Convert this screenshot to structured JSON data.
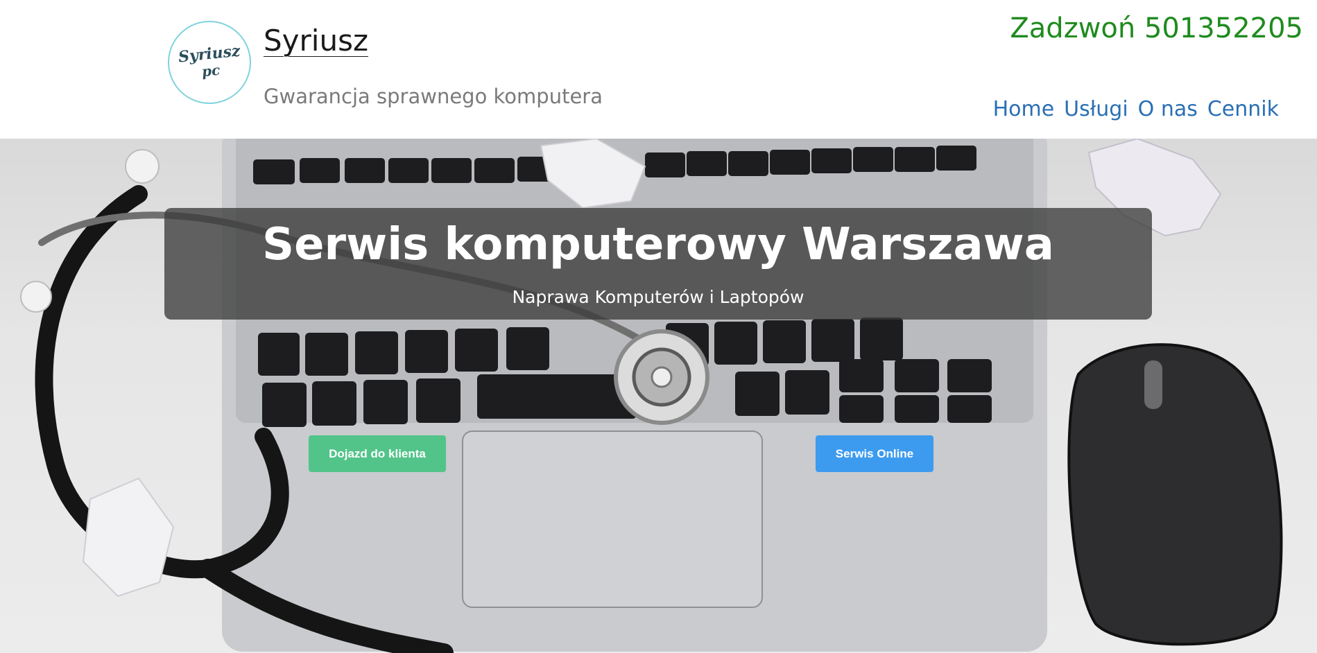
{
  "header": {
    "logo_line1": "Syriusz",
    "logo_line2": "pc",
    "site_title": "Syriusz",
    "tagline": "Gwarancja sprawnego komputera",
    "phone": "Zadzwoń 501352205"
  },
  "nav": {
    "items": [
      {
        "label": "Home"
      },
      {
        "label": "Usługi"
      },
      {
        "label": "O nas"
      },
      {
        "label": "Cennik"
      }
    ]
  },
  "hero": {
    "title": "Serwis komputerowy Warszawa",
    "subtitle": "Naprawa Komputerów i Laptopów",
    "button_left": "Dojazd do klienta",
    "button_right": "Serwis Online"
  },
  "colors": {
    "phone": "#1e8b1e",
    "nav_link": "#2a6fb3",
    "button_green": "#52c48a",
    "button_blue": "#3d9bef",
    "logo_ring": "#7fd3dc"
  }
}
